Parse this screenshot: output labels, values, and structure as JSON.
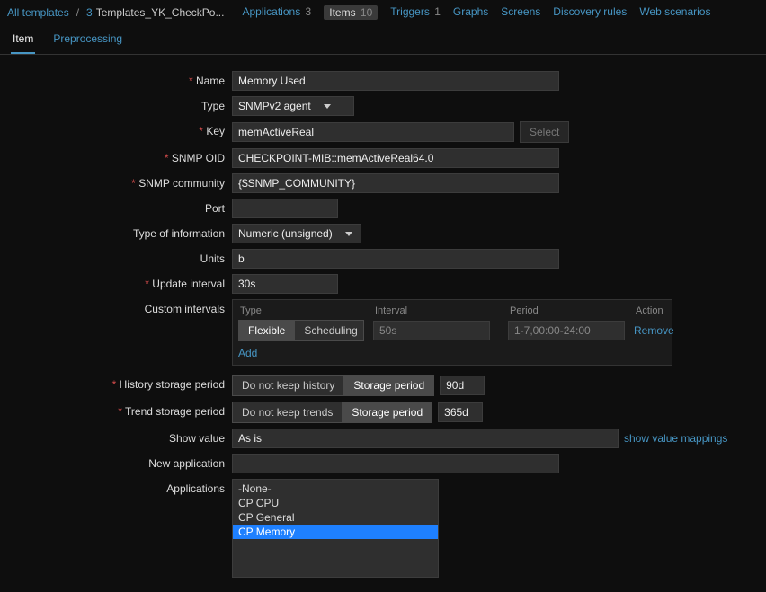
{
  "breadcrumb": {
    "root": "All templates",
    "count": "3",
    "current": "Templates_YK_CheckPo..."
  },
  "nav": {
    "applications": {
      "label": "Applications",
      "count": "3"
    },
    "items": {
      "label": "Items",
      "count": "10"
    },
    "triggers": {
      "label": "Triggers",
      "count": "1"
    },
    "graphs": {
      "label": "Graphs"
    },
    "screens": {
      "label": "Screens"
    },
    "discovery": {
      "label": "Discovery rules"
    },
    "web": {
      "label": "Web scenarios"
    }
  },
  "subtabs": {
    "item": "Item",
    "preprocessing": "Preprocessing"
  },
  "labels": {
    "name": "Name",
    "type": "Type",
    "key": "Key",
    "snmp_oid": "SNMP OID",
    "snmp_community": "SNMP community",
    "port": "Port",
    "type_info": "Type of information",
    "units": "Units",
    "update_interval": "Update interval",
    "custom_intervals": "Custom intervals",
    "history": "History storage period",
    "trend": "Trend storage period",
    "show_value": "Show value",
    "new_app": "New application",
    "applications": "Applications"
  },
  "values": {
    "name": "Memory Used",
    "type_select": "SNMPv2 agent",
    "key": "memActiveReal",
    "select_btn": "Select",
    "snmp_oid": "CHECKPOINT-MIB::memActiveReal64.0",
    "snmp_community": "{$SNMP_COMMUNITY}",
    "port": "",
    "type_info_select": "Numeric (unsigned)",
    "units": "b",
    "update_interval": "30s",
    "show_value_select": "As is",
    "show_value_link": "show value mappings",
    "new_app": ""
  },
  "custom": {
    "head_type": "Type",
    "head_interval": "Interval",
    "head_period": "Period",
    "head_action": "Action",
    "flexible": "Flexible",
    "scheduling": "Scheduling",
    "interval_val": "50s",
    "period_val": "1-7,00:00-24:00",
    "remove": "Remove",
    "add": "Add"
  },
  "history": {
    "no_keep": "Do not keep history",
    "storage": "Storage period",
    "value": "90d"
  },
  "trend": {
    "no_keep": "Do not keep trends",
    "storage": "Storage period",
    "value": "365d"
  },
  "apps": {
    "none": "-None-",
    "cpu": "CP CPU",
    "general": "CP General",
    "memory": "CP Memory"
  }
}
